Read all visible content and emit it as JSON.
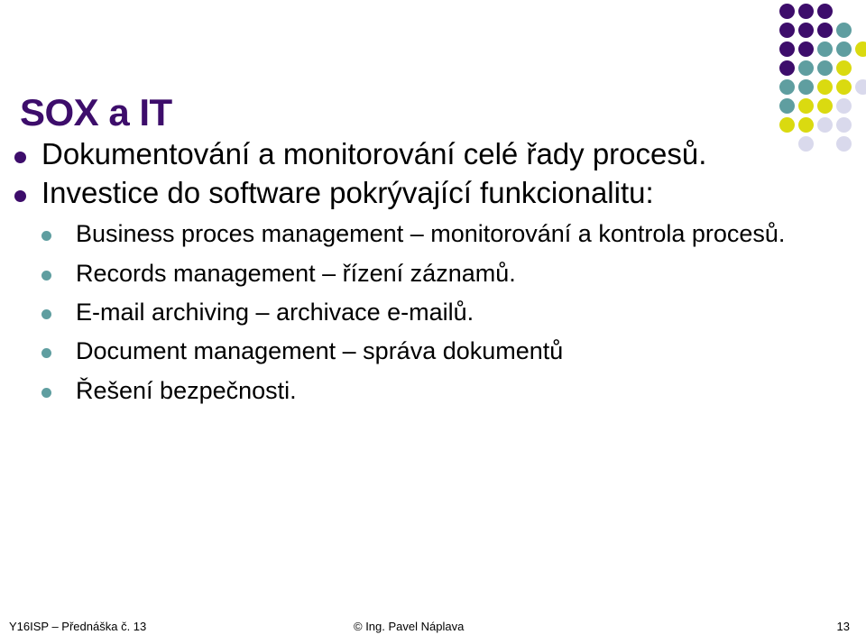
{
  "slide": {
    "title": "SOX a IT",
    "title_color": "#3d0d6b",
    "background_color": "#ffffff",
    "bullet_color_level1": "#3d0d6b",
    "bullet_color_level2": "#5f9ea0",
    "bullets": [
      {
        "level": 1,
        "text": "Dokumentování a monitorování celé řady procesů."
      },
      {
        "level": 1,
        "text": "Investice do software pokrývající funkcionalitu:",
        "children": [
          {
            "level": 2,
            "text": "Business proces management – monitorování a kontrola procesů."
          },
          {
            "level": 2,
            "text": "Records management – řízení záznamů."
          },
          {
            "level": 2,
            "text": "E-mail archiving – archivace e-mailů."
          },
          {
            "level": 2,
            "text": "Document management – správa dokumentů"
          },
          {
            "level": 2,
            "text": "Řešení bezpečnosti."
          }
        ]
      }
    ]
  },
  "decoration": {
    "name": "dot-grid",
    "columns": 5,
    "rows": 8,
    "cell": 21,
    "dot_size": 17,
    "palette": {
      "purple": "#3d0d6b",
      "teal": "#5f9ea0",
      "yellow": "#dada10",
      "lavender": "#d9d9ec",
      "empty": null
    },
    "matrix": [
      [
        "purple",
        "purple",
        "purple",
        "empty",
        "empty"
      ],
      [
        "purple",
        "purple",
        "purple",
        "teal",
        "empty"
      ],
      [
        "purple",
        "purple",
        "teal",
        "teal",
        "yellow"
      ],
      [
        "purple",
        "teal",
        "teal",
        "yellow",
        "empty"
      ],
      [
        "teal",
        "teal",
        "yellow",
        "yellow",
        "lavender"
      ],
      [
        "teal",
        "yellow",
        "yellow",
        "lavender",
        "empty"
      ],
      [
        "yellow",
        "yellow",
        "lavender",
        "lavender",
        "empty"
      ],
      [
        "empty",
        "lavender",
        "empty",
        "lavender",
        "empty"
      ]
    ]
  },
  "footer": {
    "left": "Y16ISP – Přednáška č. 13",
    "center": "© Ing. Pavel Náplava",
    "page_number": "13"
  }
}
